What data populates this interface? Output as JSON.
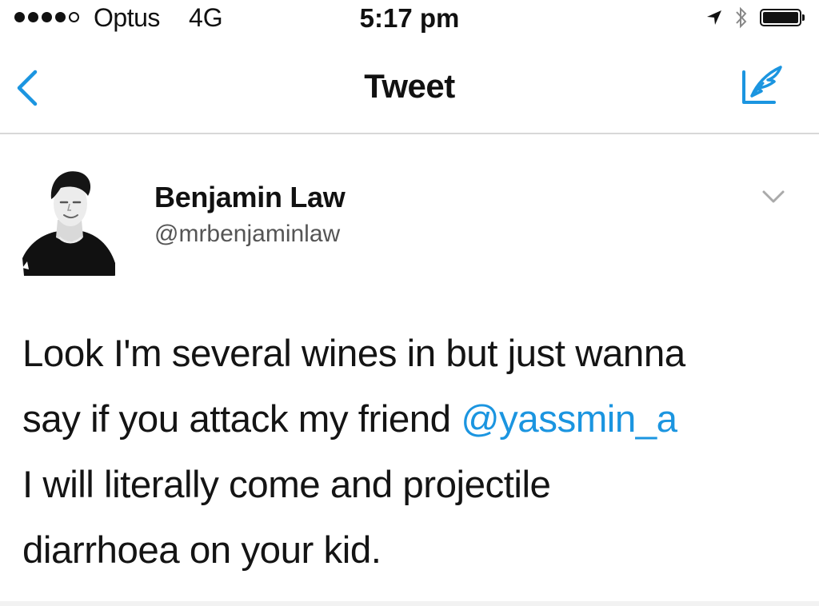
{
  "status_bar": {
    "signal_bars_filled": 4,
    "signal_bars_total": 5,
    "carrier": "Optus",
    "network": "4G",
    "time": "5:17 pm",
    "battery_level": 1.0,
    "icons": [
      "location-arrow-icon",
      "bluetooth-icon",
      "battery-icon"
    ]
  },
  "nav": {
    "title": "Tweet",
    "back_icon": "chevron-left-icon",
    "compose_icon": "compose-tweet-icon",
    "accent_color": "#1b95e0"
  },
  "tweet": {
    "author_name": "Benjamin Law",
    "author_handle": "@mrbenjaminlaw",
    "menu_icon": "chevron-down-icon",
    "text_line1": "Look I'm several wines in but just wanna",
    "text_line2_before": "say if you attack my friend ",
    "mention": "@yassmin_a",
    "text_line3": "I will literally come and projectile",
    "text_line4": "diarrhoea on your kid."
  }
}
